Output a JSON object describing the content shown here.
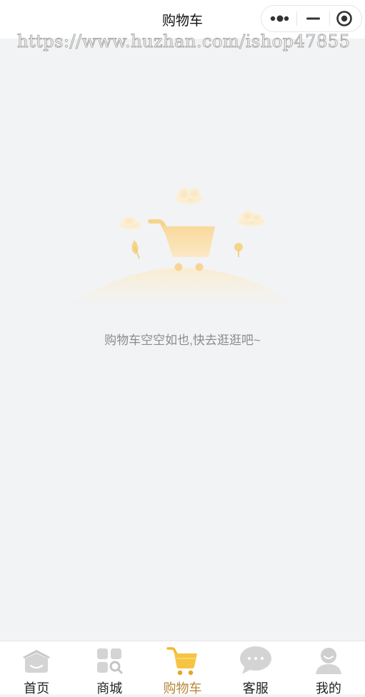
{
  "navbar": {
    "title": "购物车",
    "more_icon": "more-dots-icon",
    "minimize_icon": "minimize-icon",
    "close_icon": "close-target-icon"
  },
  "watermark": "https://www.huzhan.com/ishop47855",
  "empty_state": {
    "text": "购物车空空如也,快去逛逛吧~",
    "illustration": "empty-cart-illustration"
  },
  "tabbar": {
    "items": [
      {
        "label": "首页",
        "icon": "home-icon",
        "active": false
      },
      {
        "label": "商城",
        "icon": "store-grid-icon",
        "active": false
      },
      {
        "label": "购物车",
        "icon": "cart-icon",
        "active": true
      },
      {
        "label": "客服",
        "icon": "chat-bubble-icon",
        "active": false
      },
      {
        "label": "我的",
        "icon": "user-icon",
        "active": false
      }
    ]
  },
  "colors": {
    "background": "#f2f3f5",
    "active_tab": "#b8863b",
    "cart_yellow": "#f5c242"
  }
}
